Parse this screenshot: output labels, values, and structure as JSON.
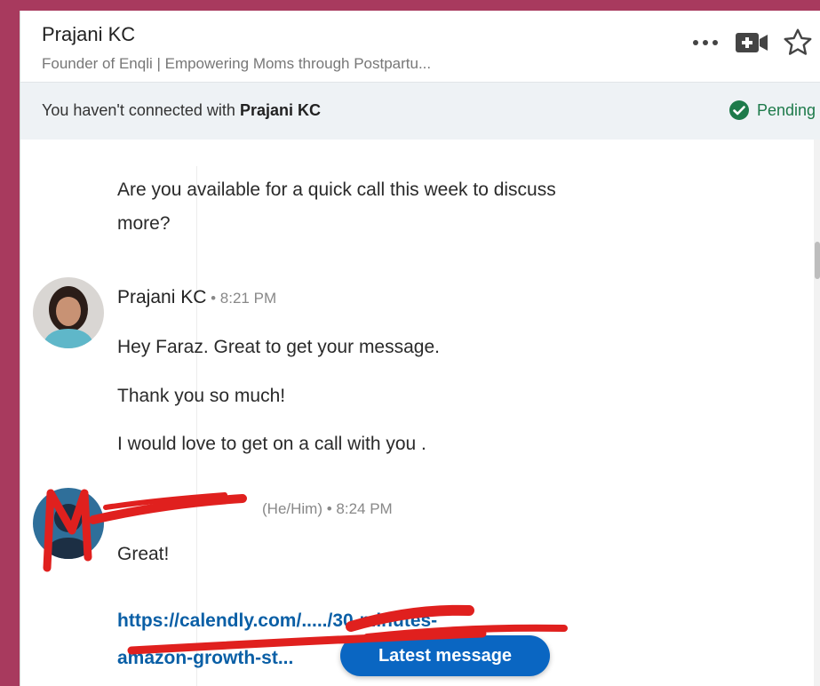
{
  "header": {
    "name": "Prajani KC",
    "headline": "Founder of Enqli | Empowering Moms through Postpartu...",
    "icons": [
      "more-options-icon",
      "video-call-icon",
      "star-icon"
    ]
  },
  "connection": {
    "prefix": "You haven't connected with ",
    "name": "Prajani KC",
    "status": "Pending",
    "status_color": "#1d7a4a"
  },
  "thread": {
    "prev_message_line1": "Are you available for a quick call this week to discuss",
    "prev_message_line2": "more?",
    "msg1": {
      "sender": "Prajani KC",
      "time": " • 8:21 PM",
      "lines": [
        "Hey Faraz. Great to get your message.",
        "Thank you so much!",
        "I would love to get on a call with you ."
      ]
    },
    "msg2": {
      "pronouns_time": "(He/Him) • 8:24 PM",
      "text": "Great!",
      "link_line1": "https://calendly.com/...../30-minutes-",
      "link_line2": "amazon-growth-st..."
    },
    "latest_button": "Latest message"
  },
  "colors": {
    "accent": "#0a66c2",
    "frame": "#a83a5e",
    "redaction": "#e0201e"
  }
}
